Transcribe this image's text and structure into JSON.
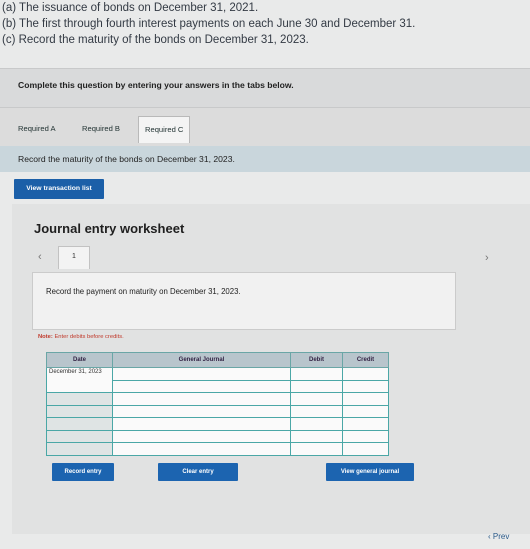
{
  "question_lines": [
    "(a) The issuance of bonds on December 31, 2021.",
    "(b) The first through fourth interest payments on each June 30 and December 31.",
    "(c) Record the maturity of the bonds on December 31, 2023."
  ],
  "instructions": "Complete this question by entering your answers in the tabs below.",
  "tabs": [
    {
      "label": "Required A"
    },
    {
      "label": "Required B"
    },
    {
      "label": "Required C"
    }
  ],
  "prompt": "Record the maturity of the bonds on December 31, 2023.",
  "buttons": {
    "view_transaction_list": "View transaction list",
    "record_entry": "Record entry",
    "clear_entry": "Clear entry",
    "view_general_journal": "View general journal",
    "prev": "Prev"
  },
  "worksheet": {
    "title": "Journal entry worksheet",
    "page_number": "1",
    "entry_description": "Record the payment on maturity on December 31, 2023.",
    "note_label": "Note:",
    "note_text": "Enter debits before credits."
  },
  "journal_table": {
    "headers": [
      "Date",
      "General Journal",
      "Debit",
      "Credit"
    ],
    "date_value": "December 31, 2023"
  },
  "colors": {
    "accent_button": "#1c64b0",
    "prompt_bar": "#c9d6dc",
    "grid_border": "#4aa7a6"
  }
}
